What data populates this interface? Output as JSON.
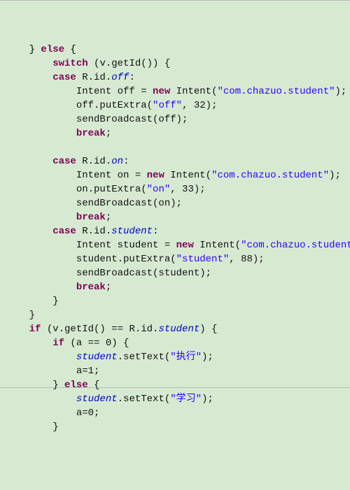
{
  "code": {
    "l01a": "    }",
    "l01b": "else",
    "l01c": " {",
    "l02a": "        ",
    "l02b": "switch",
    "l02c": " (v.getId()) {",
    "l03a": "        ",
    "l03b": "case",
    "l03c": " R.id.",
    "l03d": "off",
    "l03e": ":",
    "l04a": "            Intent off = ",
    "l04b": "new",
    "l04c": " Intent(",
    "l04d": "\"com.chazuo.student\"",
    "l04e": ");",
    "l05a": "            off.putExtra(",
    "l05b": "\"off\"",
    "l05c": ", 32);",
    "l06a": "            sendBroadcast(off);",
    "l07a": "            ",
    "l07b": "break",
    "l07c": ";",
    "l08": "",
    "l09a": "        ",
    "l09b": "case",
    "l09c": " R.id.",
    "l09d": "on",
    "l09e": ":",
    "l10a": "            Intent on = ",
    "l10b": "new",
    "l10c": " Intent(",
    "l10d": "\"com.chazuo.student\"",
    "l10e": ");",
    "l11a": "            on.putExtra(",
    "l11b": "\"on\"",
    "l11c": ", 33);",
    "l12a": "            sendBroadcast(on);",
    "l13a": "            ",
    "l13b": "break",
    "l13c": ";",
    "l14a": "        ",
    "l14b": "case",
    "l14c": " R.id.",
    "l14d": "student",
    "l14e": ":",
    "l15a": "            Intent student = ",
    "l15b": "new",
    "l15c": " Intent(",
    "l15d": "\"com.chazuo.student\"",
    "l15e": ");",
    "l16a": "            student.putExtra(",
    "l16b": "\"student\"",
    "l16c": ", 88);",
    "l17a": "            sendBroadcast(student);",
    "l18a": "            ",
    "l18b": "break",
    "l18c": ";",
    "l19": "        }",
    "l20": "    }",
    "l21a": "    ",
    "l21b": "if",
    "l21c": " (v.getId() == R.id.",
    "l21d": "student",
    "l21e": ") {",
    "l22a": "        ",
    "l22b": "if",
    "l22c": " (a == 0) {",
    "l23a": "            ",
    "l23b": "student",
    "l23c": ".setText(",
    "l23d": "\"执行\"",
    "l23e": ");",
    "l24": "            a=1;",
    "l25a": "        } ",
    "l25b": "else",
    "l25c": " {",
    "l26a": "            ",
    "l26b": "student",
    "l26c": ".setText(",
    "l26d": "\"学习\"",
    "l26e": ");",
    "l27": "            a=0;",
    "l28": "        }"
  }
}
